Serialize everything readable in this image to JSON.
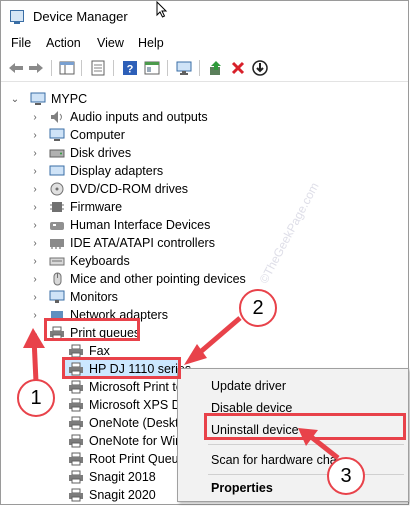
{
  "window": {
    "title": "Device Manager"
  },
  "menu": [
    "File",
    "Action",
    "View",
    "Help"
  ],
  "tree": {
    "root": "MYPC",
    "categories": [
      "Audio inputs and outputs",
      "Computer",
      "Disk drives",
      "Display adapters",
      "DVD/CD-ROM drives",
      "Firmware",
      "Human Interface Devices",
      "IDE ATA/ATAPI controllers",
      "Keyboards",
      "Mice and other pointing devices",
      "Monitors",
      "Network adapters"
    ],
    "expanded": "Print queues",
    "children": [
      "Fax",
      "HP DJ 1110 series",
      "Microsoft Print to",
      "Microsoft XPS Do",
      "OneNote (Deskto",
      "OneNote for Win",
      "Root Print Queue",
      "Snagit 2018",
      "Snagit 2020"
    ]
  },
  "context_menu": {
    "items": [
      "Update driver",
      "Disable device",
      "Uninstall device",
      "Scan for hardware cha",
      "Properties"
    ]
  },
  "callouts": [
    "1",
    "2",
    "3"
  ],
  "watermark": "©TheGeekPage.com",
  "colors": {
    "annotation_red": "#e8424a",
    "selection": "#cce8ff"
  }
}
